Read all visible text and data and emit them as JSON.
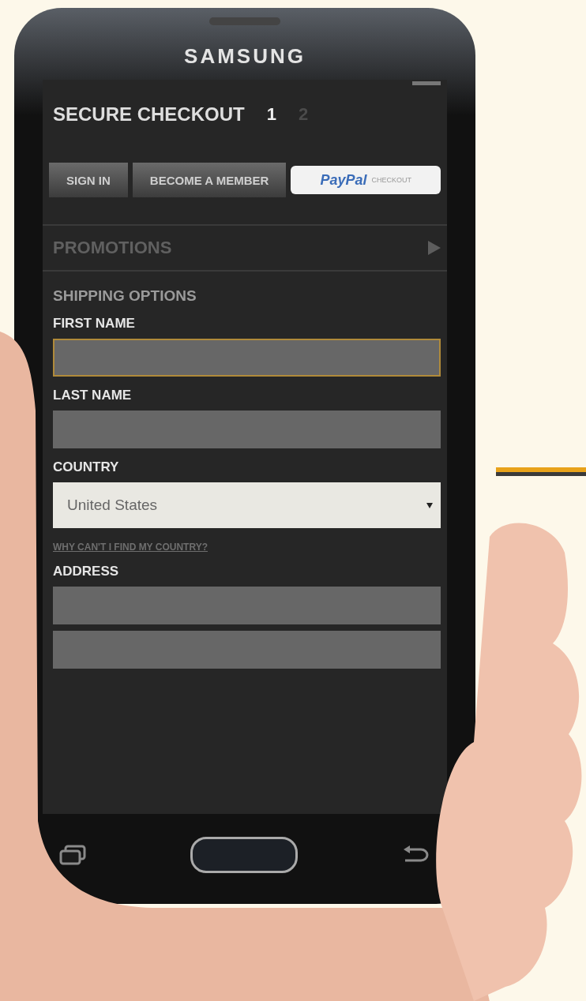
{
  "device": {
    "brand": "SAMSUNG"
  },
  "header": {
    "title": "SECURE CHECKOUT",
    "steps": [
      {
        "label": "1",
        "selected": true
      },
      {
        "label": "2",
        "selected": false
      }
    ]
  },
  "auth_buttons": [
    {
      "label": "SIGN IN",
      "kind": "plain"
    },
    {
      "label": "BECOME A MEMBER",
      "kind": "plain"
    },
    {
      "label": "PayPal",
      "sublabel": "CHECKOUT",
      "kind": "paypal"
    }
  ],
  "promotions": {
    "label": "PROMOTIONS"
  },
  "section_title": "SHIPPING OPTIONS",
  "fields": [
    {
      "label": "FIRST NAME",
      "kind": "text",
      "inputs": [
        {
          "focused": true
        }
      ]
    },
    {
      "label": "LAST NAME",
      "kind": "text",
      "inputs": [
        {
          "focused": false
        }
      ]
    },
    {
      "label": "COUNTRY",
      "kind": "select",
      "value": "United States",
      "help_link": "WHY CAN'T I FIND MY COUNTRY?"
    },
    {
      "label": "ADDRESS",
      "kind": "text",
      "inputs": [
        {
          "focused": false
        },
        {
          "focused": false
        }
      ]
    }
  ]
}
